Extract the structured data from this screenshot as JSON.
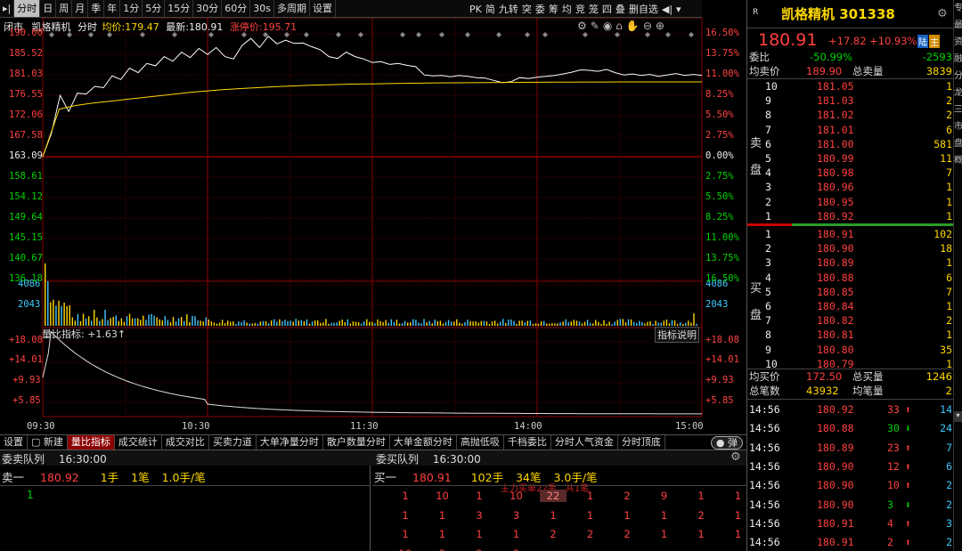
{
  "toolbar": {
    "items": [
      "分时",
      "日",
      "周",
      "月",
      "季",
      "年",
      "1分",
      "5分",
      "15分",
      "30分",
      "60分",
      "30s",
      "多周期",
      "设置"
    ],
    "right_items": [
      "PK",
      "简",
      "九转",
      "突",
      "委",
      "筹",
      "均",
      "竞",
      "笼",
      "四",
      "叠",
      "删自选"
    ]
  },
  "chart_header": {
    "status": "闭市",
    "name": "凯格精机",
    "mode": "分时",
    "avg_label": "均价:",
    "avg_value": "179.47",
    "last_label": "最新:",
    "last_value": "180.91",
    "limit_label": "涨停价:",
    "limit_value": "195.71"
  },
  "price_axis_left": [
    "190.00",
    "185.52",
    "181.03",
    "176.55",
    "172.06",
    "167.58",
    "163.09",
    "158.61",
    "154.12",
    "149.64",
    "145.15",
    "140.67",
    "136.18"
  ],
  "pct_axis_right": [
    "16.50%",
    "13.75%",
    "11.00%",
    "8.25%",
    "5.50%",
    "2.75%",
    "0.00%",
    "2.75%",
    "5.50%",
    "8.25%",
    "11.00%",
    "13.75%",
    "16.50%"
  ],
  "volume_axis": [
    "4086",
    "2043"
  ],
  "indicator": {
    "label": "量比指标: +1.63↑",
    "button": "指标说明",
    "axis": [
      "+18.08",
      "+14.01",
      "+9.93",
      "+5.85"
    ]
  },
  "time_axis": [
    "09:30",
    "10:30",
    "11:30",
    "14:00",
    "15:00"
  ],
  "chart_data": {
    "type": "line",
    "x_range": [
      "09:30",
      "15:00"
    ],
    "ylim": [
      136.18,
      190.0
    ],
    "prev_close": 163.09,
    "series": [
      {
        "name": "最新",
        "color": "#ffffff",
        "values": [
          163.09,
          168.2,
          176.5,
          173.0,
          177.0,
          176.8,
          178.5,
          178.2,
          180.8,
          180.0,
          182.5,
          181.5,
          183.5,
          183.0,
          185.0,
          184.0,
          186.0,
          184.8,
          186.8,
          185.5,
          187.0,
          185.0,
          184.5,
          187.5,
          189.0,
          187.0,
          189.5,
          187.8,
          188.6,
          187.9,
          188.0,
          187.2,
          186.5,
          185.0,
          184.6,
          186.0,
          185.0,
          184.5,
          183.7,
          183.9,
          183.3,
          183.5,
          183.1,
          182.8,
          181.0,
          180.8,
          180.9,
          180.6,
          180.9,
          180.7,
          180.4,
          180.3,
          179.8,
          179.3,
          179.5,
          180.4,
          180.2,
          180.5,
          180.7,
          180.9,
          181.2,
          181.6,
          182.1,
          182.0,
          181.8,
          182.2,
          181.5,
          181.0,
          181.2,
          180.9,
          181.1,
          180.7,
          181.0,
          181.3,
          180.9,
          181.1,
          180.91
        ]
      },
      {
        "name": "均价",
        "color": "#ffd700",
        "values": [
          163.09,
          173.5,
          174.3,
          174.8,
          175.2,
          175.6,
          176.0,
          176.4,
          176.8,
          177.2,
          177.5,
          177.8,
          178.0,
          178.2,
          178.4,
          178.55,
          178.7,
          178.8,
          178.9,
          179.0,
          179.05,
          179.1,
          179.15,
          179.2,
          179.25,
          179.28,
          179.3,
          179.32,
          179.35,
          179.37,
          179.4,
          179.42,
          179.44,
          179.45,
          179.46,
          179.47,
          179.47,
          179.47,
          179.47,
          179.47,
          179.47
        ]
      }
    ]
  },
  "right_panel": {
    "badge": "R",
    "title": "凯格精机 301338",
    "price": "180.91",
    "change": "+17.82",
    "pct": "+10.93%",
    "tag1": "陆",
    "tag2": "主",
    "weibi_label": "委比",
    "weibi": "-50.99%",
    "weicha": "-2593",
    "avg_sell_label": "均卖价",
    "avg_sell": "189.90",
    "total_sell_label": "总卖量",
    "total_sell": "3839",
    "sell_side_label": [
      "卖",
      "盘"
    ],
    "buy_side_label": [
      "买",
      "盘"
    ],
    "asks": [
      [
        "10",
        "181.05",
        "1"
      ],
      [
        "9",
        "181.03",
        "2"
      ],
      [
        "8",
        "181.02",
        "2"
      ],
      [
        "7",
        "181.01",
        "6"
      ],
      [
        "6",
        "181.00",
        "581"
      ],
      [
        "5",
        "180.99",
        "11"
      ],
      [
        "4",
        "180.98",
        "7"
      ],
      [
        "3",
        "180.96",
        "1"
      ],
      [
        "2",
        "180.95",
        "1"
      ],
      [
        "1",
        "180.92",
        "1"
      ]
    ],
    "bids": [
      [
        "1",
        "180.91",
        "102"
      ],
      [
        "2",
        "180.90",
        "18"
      ],
      [
        "3",
        "180.89",
        "1"
      ],
      [
        "4",
        "180.88",
        "6"
      ],
      [
        "5",
        "180.85",
        "7"
      ],
      [
        "6",
        "180.84",
        "1"
      ],
      [
        "7",
        "180.82",
        "2"
      ],
      [
        "8",
        "180.81",
        "1"
      ],
      [
        "9",
        "180.80",
        "35"
      ],
      [
        "10",
        "180.79",
        "1"
      ]
    ],
    "avg_buy_label": "均买价",
    "avg_buy": "172.50",
    "total_buy_label": "总买量",
    "total_buy": "1246",
    "total_trades_label": "总笔数",
    "total_trades": "43932",
    "avg_lot_label": "均笔量",
    "avg_lot": "2",
    "ticks": [
      [
        "14:56",
        "180.92",
        "33",
        "14"
      ],
      [
        "14:56",
        "180.88",
        "30",
        "24"
      ],
      [
        "14:56",
        "180.89",
        "23",
        "7"
      ],
      [
        "14:56",
        "180.90",
        "12",
        "6"
      ],
      [
        "14:56",
        "180.90",
        "10",
        "2"
      ],
      [
        "14:56",
        "180.90",
        "3",
        "2"
      ],
      [
        "14:56",
        "180.91",
        "4",
        "3"
      ],
      [
        "14:56",
        "180.91",
        "2",
        "2"
      ]
    ],
    "tick_colors": [
      "red",
      "grn",
      "red",
      "red",
      "red",
      "grn",
      "red",
      "red"
    ],
    "side_strip": "专 最 资 融 分 龙 三 市 盘 概"
  },
  "bottom_tabs": [
    "设置",
    "新建",
    "量比指标",
    "成交统计",
    "成交对比",
    "买卖力道",
    "大单净量分时",
    "散户数量分时",
    "大单金额分时",
    "高抛低吸",
    "千档委比",
    "分时人气资金",
    "分时顶底"
  ],
  "toggle_label": "弹",
  "sell_queue": {
    "title": "委卖队列",
    "time": "16:30:00",
    "row_label": "卖一",
    "price": "180.92",
    "hands": "1手",
    "trades": "1笔",
    "avg": "1.0手/笔",
    "values": [
      "1"
    ]
  },
  "buy_queue": {
    "title": "委买队列",
    "time": "16:30:00",
    "row_label": "买一",
    "price": "180.91",
    "hands": "102手",
    "trades": "34笔",
    "avg": "3.0手/笔",
    "note": "主力买单22手，共1笔",
    "rows": [
      [
        "1",
        "10",
        "1",
        "10",
        "22",
        "1",
        "2",
        "9",
        "1",
        "1"
      ],
      [
        "1",
        "1",
        "3",
        "3",
        "1",
        "1",
        "1",
        "1",
        "2",
        "1"
      ],
      [
        "1",
        "1",
        "1",
        "1",
        "2",
        "2",
        "2",
        "1",
        "1",
        "1"
      ],
      [
        "10",
        "2",
        "2",
        "2",
        "",
        "",
        "",
        "",
        "",
        ""
      ]
    ]
  }
}
